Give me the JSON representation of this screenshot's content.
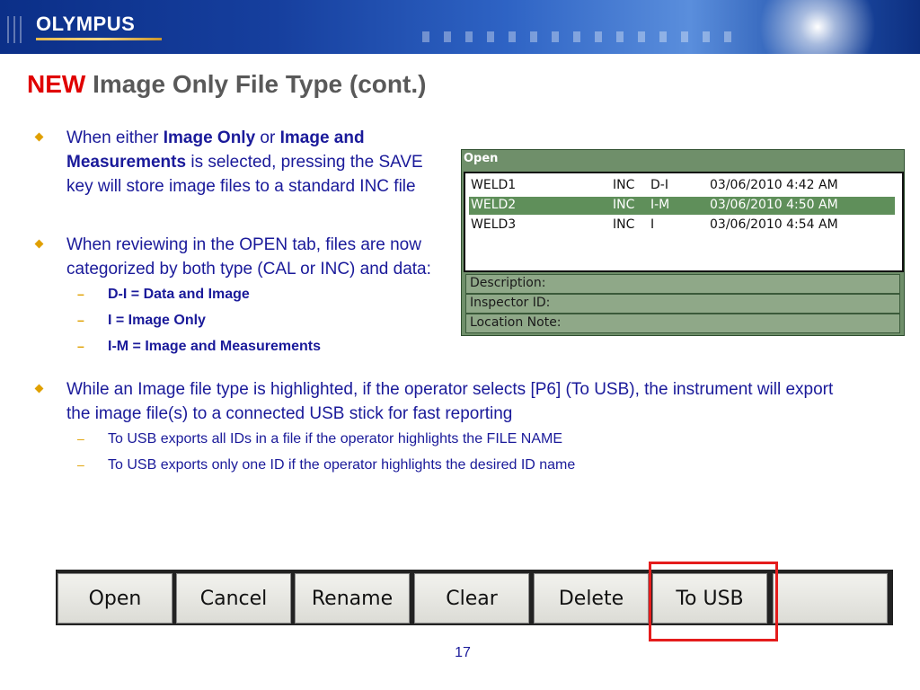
{
  "header": {
    "logo": "OLYMPUS"
  },
  "title": {
    "highlight": "NEW",
    "text": "Image Only File Type (cont.)"
  },
  "bullets": [
    {
      "parts": [
        "When either ",
        "Image Only",
        " or ",
        "Image and Measurements",
        " is selected, pressing the SAVE key will store image files to a standard INC file"
      ]
    },
    {
      "text": "When reviewing in the OPEN tab, files are now categorized by both type (CAL or INC) and data:",
      "subitems": [
        "D-I = Data and Image",
        "I = Image Only",
        "I-M = Image and Measurements"
      ]
    },
    {
      "text": "While an Image file type is highlighted, if the operator selects [P6] (To USB), the instrument will export the image file(s) to a connected USB stick for fast reporting",
      "subitems": [
        "To USB exports all IDs in a file if the operator highlights the FILE NAME",
        "To USB exports only one ID if the operator highlights the desired ID name"
      ]
    }
  ],
  "open_dialog": {
    "title": "Open",
    "files": [
      {
        "name": "WELD1",
        "type": "INC",
        "data": "D-I",
        "date": "03/06/2010 4:42 AM",
        "selected": false
      },
      {
        "name": "WELD2",
        "type": "INC",
        "data": "I-M",
        "date": "03/06/2010 4:50 AM",
        "selected": true
      },
      {
        "name": "WELD3",
        "type": "INC",
        "data": "I",
        "date": "03/06/2010 4:54 AM",
        "selected": false
      }
    ],
    "fields": [
      "Description:",
      "Inspector ID:",
      "Location Note:"
    ]
  },
  "softkeys": [
    "Open",
    "Cancel",
    "Rename",
    "Clear",
    "Delete",
    "To USB",
    ""
  ],
  "highlighted_softkey": "To USB",
  "colors": {
    "title_new": "#e00000",
    "bullet_text": "#1a1a9a",
    "bullet_marker": "#e0a000",
    "selection": "#5f8f5a",
    "highlight_box": "#e41c1c"
  },
  "page_number": "17"
}
